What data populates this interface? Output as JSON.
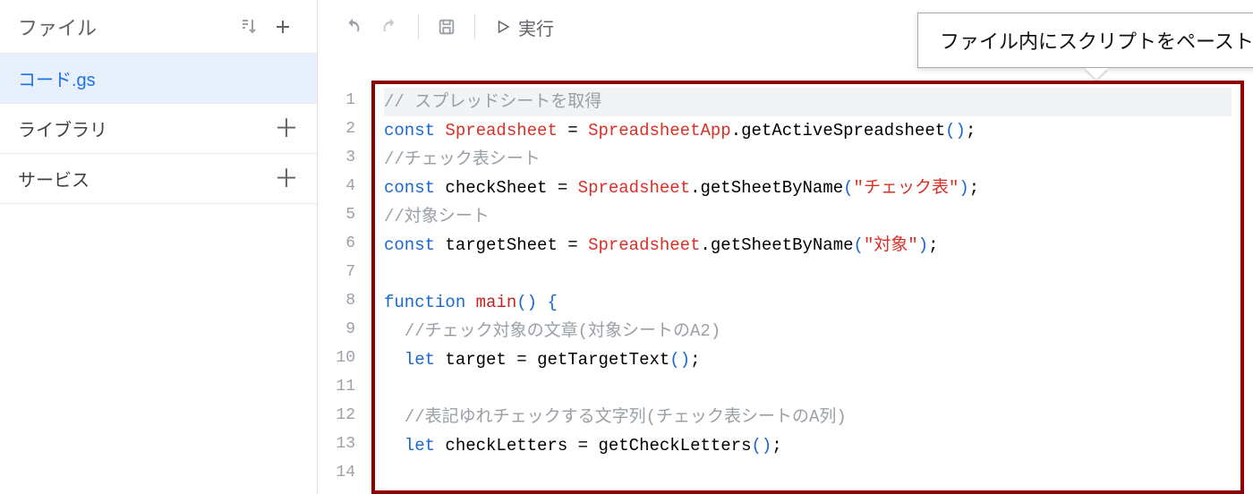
{
  "sidebar": {
    "title": "ファイル",
    "items": [
      {
        "label": "コード.gs",
        "active": true
      },
      {
        "label": "ライブラリ",
        "add": true
      },
      {
        "label": "サービス",
        "add": true
      }
    ]
  },
  "toolbar": {
    "run_label": "実行"
  },
  "callout": {
    "text": "ファイル内にスクリプトをペースト"
  },
  "code": {
    "lines": [
      {
        "n": 1,
        "current": true,
        "tokens": [
          {
            "t": "// スプレッドシートを取得",
            "c": "tk-comment"
          }
        ]
      },
      {
        "n": 2,
        "tokens": [
          {
            "t": "const ",
            "c": "tk-kw"
          },
          {
            "t": "Spreadsheet",
            "c": "tk-class"
          },
          {
            "t": " = ",
            "c": "tk-ident"
          },
          {
            "t": "SpreadsheetApp",
            "c": "tk-class"
          },
          {
            "t": ".",
            "c": "tk-ident"
          },
          {
            "t": "getActiveSpreadsheet",
            "c": "tk-ident"
          },
          {
            "t": "()",
            "c": "tk-punc"
          },
          {
            "t": ";",
            "c": "tk-ident"
          }
        ]
      },
      {
        "n": 3,
        "tokens": [
          {
            "t": "//チェック表シート",
            "c": "tk-comment"
          }
        ]
      },
      {
        "n": 4,
        "tokens": [
          {
            "t": "const ",
            "c": "tk-kw"
          },
          {
            "t": "checkSheet",
            "c": "tk-ident"
          },
          {
            "t": " = ",
            "c": "tk-ident"
          },
          {
            "t": "Spreadsheet",
            "c": "tk-class"
          },
          {
            "t": ".",
            "c": "tk-ident"
          },
          {
            "t": "getSheetByName",
            "c": "tk-ident"
          },
          {
            "t": "(",
            "c": "tk-punc"
          },
          {
            "t": "\"チェック表\"",
            "c": "tk-str"
          },
          {
            "t": ")",
            "c": "tk-punc"
          },
          {
            "t": ";",
            "c": "tk-ident"
          }
        ]
      },
      {
        "n": 5,
        "tokens": [
          {
            "t": "//対象シート",
            "c": "tk-comment"
          }
        ]
      },
      {
        "n": 6,
        "tokens": [
          {
            "t": "const ",
            "c": "tk-kw"
          },
          {
            "t": "targetSheet",
            "c": "tk-ident"
          },
          {
            "t": " = ",
            "c": "tk-ident"
          },
          {
            "t": "Spreadsheet",
            "c": "tk-class"
          },
          {
            "t": ".",
            "c": "tk-ident"
          },
          {
            "t": "getSheetByName",
            "c": "tk-ident"
          },
          {
            "t": "(",
            "c": "tk-punc"
          },
          {
            "t": "\"対象\"",
            "c": "tk-str"
          },
          {
            "t": ")",
            "c": "tk-punc"
          },
          {
            "t": ";",
            "c": "tk-ident"
          }
        ]
      },
      {
        "n": 7,
        "tokens": [
          {
            "t": " ",
            "c": ""
          }
        ]
      },
      {
        "n": 8,
        "tokens": [
          {
            "t": "function ",
            "c": "tk-kw"
          },
          {
            "t": "main",
            "c": "tk-func"
          },
          {
            "t": "() {",
            "c": "tk-punc"
          }
        ]
      },
      {
        "n": 9,
        "tokens": [
          {
            "t": "  ",
            "c": ""
          },
          {
            "t": "//チェック対象の文章(対象シートのA2)",
            "c": "tk-comment"
          }
        ]
      },
      {
        "n": 10,
        "tokens": [
          {
            "t": "  ",
            "c": ""
          },
          {
            "t": "let ",
            "c": "tk-kw"
          },
          {
            "t": "target",
            "c": "tk-ident"
          },
          {
            "t": " = ",
            "c": "tk-ident"
          },
          {
            "t": "getTargetText",
            "c": "tk-ident"
          },
          {
            "t": "()",
            "c": "tk-punc"
          },
          {
            "t": ";",
            "c": "tk-ident"
          }
        ]
      },
      {
        "n": 11,
        "tokens": [
          {
            "t": " ",
            "c": ""
          }
        ]
      },
      {
        "n": 12,
        "tokens": [
          {
            "t": "  ",
            "c": ""
          },
          {
            "t": "//表記ゆれチェックする文字列(チェック表シートのA列)",
            "c": "tk-comment"
          }
        ]
      },
      {
        "n": 13,
        "tokens": [
          {
            "t": "  ",
            "c": ""
          },
          {
            "t": "let ",
            "c": "tk-kw"
          },
          {
            "t": "checkLetters",
            "c": "tk-ident"
          },
          {
            "t": " = ",
            "c": "tk-ident"
          },
          {
            "t": "getCheckLetters",
            "c": "tk-ident"
          },
          {
            "t": "()",
            "c": "tk-punc"
          },
          {
            "t": ";",
            "c": "tk-ident"
          }
        ]
      },
      {
        "n": 14,
        "tokens": [
          {
            "t": " ",
            "c": ""
          }
        ]
      }
    ]
  }
}
